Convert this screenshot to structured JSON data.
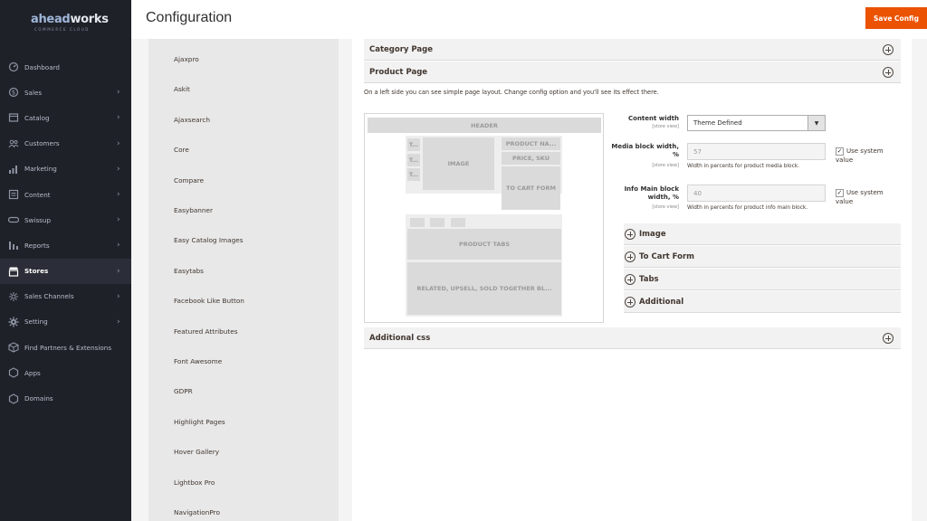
{
  "brand": {
    "logo_ahead": "ahead",
    "logo_works": "works",
    "logo_sub": "COMMERCE CLOUD"
  },
  "sidebar": {
    "items": [
      {
        "label": "Dashboard",
        "icon": "dashboard-icon",
        "arrow": false
      },
      {
        "label": "Sales",
        "icon": "dollar-icon",
        "arrow": true
      },
      {
        "label": "Catalog",
        "icon": "box-icon",
        "arrow": true
      },
      {
        "label": "Customers",
        "icon": "customers-icon",
        "arrow": true
      },
      {
        "label": "Marketing",
        "icon": "megaphone-icon",
        "arrow": true
      },
      {
        "label": "Content",
        "icon": "content-icon",
        "arrow": true
      },
      {
        "label": "Swissup",
        "icon": "swissup-icon",
        "arrow": true
      },
      {
        "label": "Reports",
        "icon": "bar-chart-icon",
        "arrow": true
      },
      {
        "label": "Stores",
        "icon": "store-icon",
        "arrow": true,
        "active": true
      },
      {
        "label": "Sales Channels",
        "icon": "channels-icon",
        "arrow": true
      },
      {
        "label": "Setting",
        "icon": "gear-icon",
        "arrow": true
      },
      {
        "label": "Find Partners & Extensions",
        "icon": "cube-icon",
        "arrow": false
      },
      {
        "label": "Apps",
        "icon": "hexagon-icon",
        "arrow": false
      },
      {
        "label": "Domains",
        "icon": "hexagon-icon",
        "arrow": false
      }
    ]
  },
  "header": {
    "title": "Configuration",
    "save_label": "Save Config"
  },
  "config_tabs": [
    "Ajaxpro",
    "Askit",
    "Ajaxsearch",
    "Core",
    "Compare",
    "Easybanner",
    "Easy Catalog Images",
    "Easytabs",
    "Facebook Like Button",
    "Featured Attributes",
    "Font Awesome",
    "GDPR",
    "Highlight Pages",
    "Hover Gallery",
    "Lightbox Pro",
    "NavigationPro"
  ],
  "sections": {
    "category_page": "Category Page",
    "product_page": "Product Page",
    "additional_css": "Additional css"
  },
  "description": "On a left side you can see simple page layout. Change config option and you'll see its effect there.",
  "preview": {
    "header": "HEADER",
    "thumb": "T...",
    "image": "IMAGE",
    "product_name": "PRODUCT NA...",
    "price": "PRICE, SKU",
    "cart_form": "TO CART FORM",
    "product_tabs": "PRODUCT TABS",
    "related": "RELATED, UPSELL, SOLD TOGETHER BL..."
  },
  "form": {
    "content_width": {
      "label": "Content width",
      "scope": "[store view]",
      "value": "Theme Defined"
    },
    "media_width": {
      "label_1": "Media block width,",
      "label_2": "%",
      "scope": "[store view]",
      "value": "57",
      "note": "Width in percents for product media block.",
      "use_system": "Use system value",
      "checked": "✓"
    },
    "info_width": {
      "label_1": "Info Main block",
      "label_2": "width, %",
      "scope": "[store view]",
      "value": "40",
      "note": "Width in percents for product info main block.",
      "use_system": "Use system value",
      "checked": "✓"
    }
  },
  "subsections": [
    "Image",
    "To Cart Form",
    "Tabs",
    "Additional"
  ]
}
